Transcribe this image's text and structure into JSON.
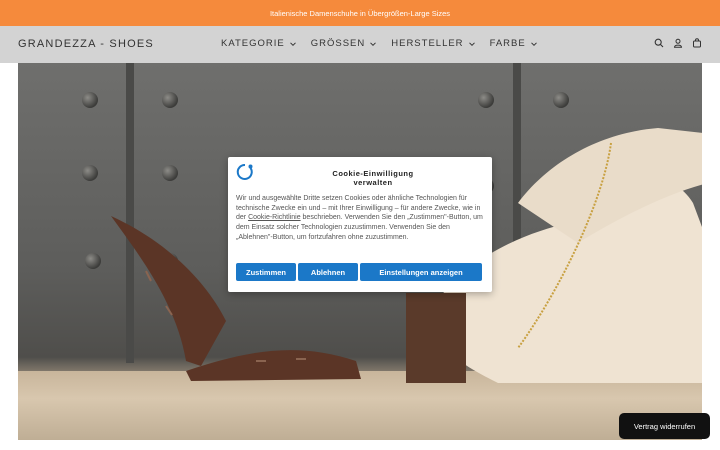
{
  "announcement": {
    "text": "Italienische Damenschuhe in Übergrößen-Large Sizes"
  },
  "header": {
    "logo": "GRANDEZZA - SHOES",
    "nav": [
      {
        "label": "KATEGORIE"
      },
      {
        "label": "GRÖSSEN"
      },
      {
        "label": "HERSTELLER"
      },
      {
        "label": "FARBE"
      }
    ],
    "icons": [
      "search-icon",
      "account-icon",
      "cart-icon"
    ]
  },
  "cookie_modal": {
    "title_line1": "Cookie-Einwilligung",
    "title_line2": "verwalten",
    "text_before_link": "Wir und ausgewählte Dritte setzen Cookies oder ähnliche Technologien für technische Zwecke ein und – mit Ihrer Einwilligung – für andere Zwecke, wie in der ",
    "link": "Cookie-Richtlinie",
    "text_after_link": " beschrieben. Verwenden Sie den „Zustimmen\"-Button, um dem Einsatz solcher Technologien zuzustimmen. Verwenden Sie den „Ablehnen\"-Button, um fortzufahren ohne zuzustimmen.",
    "buttons": {
      "accept": "Zustimmen",
      "reject": "Ablehnen",
      "settings": "Einstellungen anzeigen"
    }
  },
  "revoke_button": {
    "label": "Vertrag widerrufen"
  },
  "colors": {
    "announcement_bg": "#f58a3c",
    "header_bg": "#d3d3d3",
    "button_blue": "#1b78c8"
  }
}
